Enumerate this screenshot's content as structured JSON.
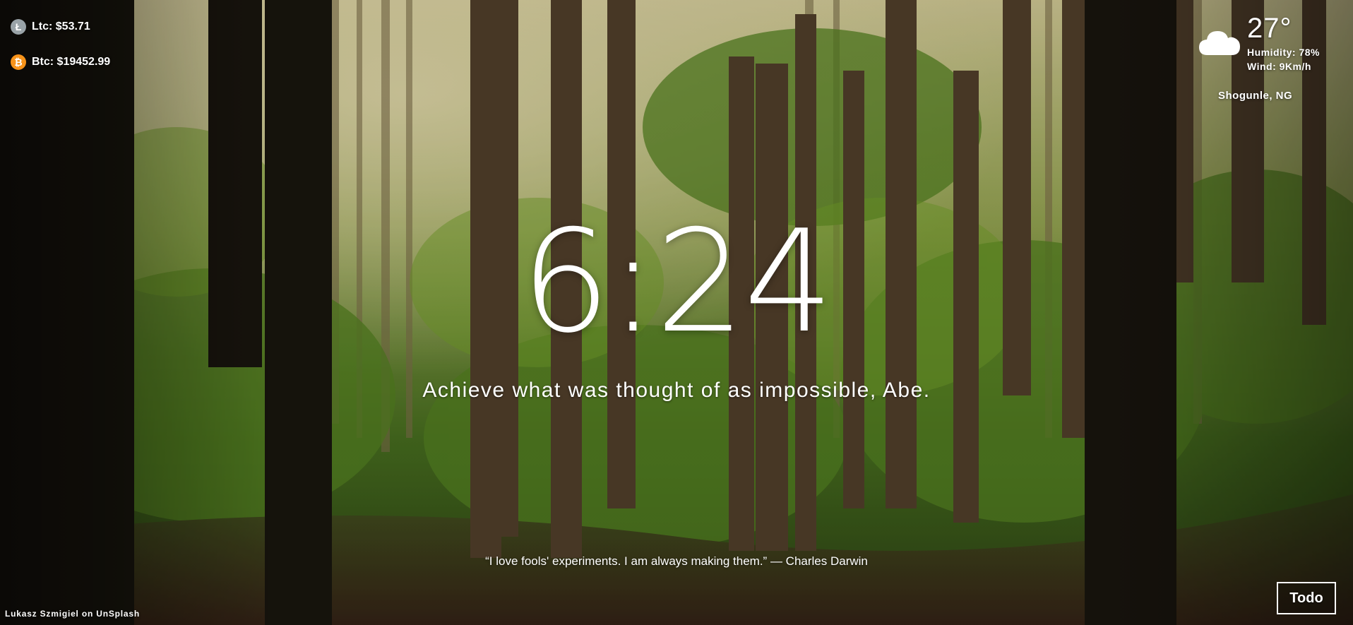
{
  "background": {
    "credit": "Lukasz Szmigiel on UnSplash"
  },
  "crypto": {
    "items": [
      {
        "symbol_icon": "litecoin-icon",
        "color": "#9aa3a8",
        "label": "Ltc: $53.71"
      },
      {
        "symbol_icon": "bitcoin-icon",
        "color": "#f7931a",
        "label": "Btc: $19452.99"
      }
    ]
  },
  "weather": {
    "icon": "cloud-icon",
    "temperature": "27°",
    "humidity": "Humidity: 78%",
    "wind": "Wind: 9Km/h",
    "location": "Shogunle, NG"
  },
  "clock": {
    "time": "6:24"
  },
  "greeting": {
    "text": "Achieve what was thought of as impossible, Abe."
  },
  "quote": {
    "text": "“I love fools' experiments. I am always making them.” — Charles Darwin"
  },
  "todo": {
    "label": "Todo"
  }
}
